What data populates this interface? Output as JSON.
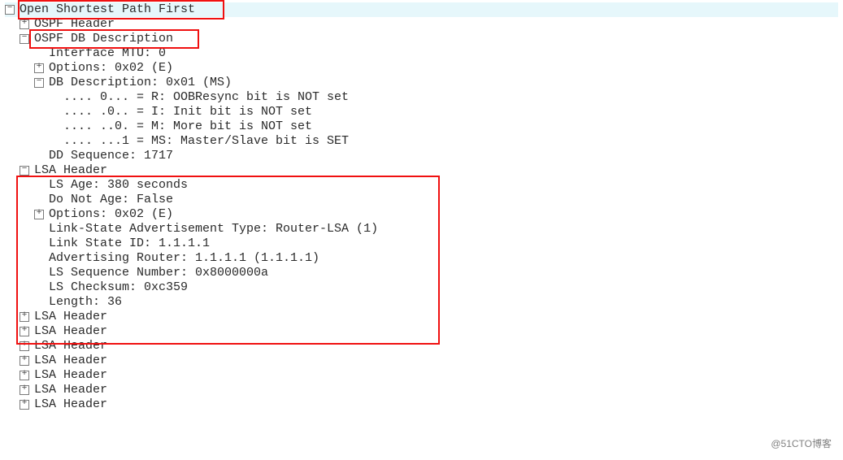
{
  "root": {
    "label": "Open Shortest Path First",
    "children": [
      {
        "label": "OSPF Header",
        "toggle": "plus"
      },
      {
        "label": "OSPF DB Description",
        "toggle": "minus",
        "children": [
          {
            "label": "Interface MTU: 0"
          },
          {
            "label": "Options: 0x02 (E)",
            "toggle": "plus"
          },
          {
            "label": "DB Description: 0x01 (MS)",
            "toggle": "minus",
            "children": [
              {
                "label": ".... 0... = R: OOBResync bit is NOT set"
              },
              {
                "label": ".... .0.. = I: Init bit is NOT set"
              },
              {
                "label": ".... ..0. = M: More bit is NOT set"
              },
              {
                "label": ".... ...1 = MS: Master/Slave bit is SET"
              }
            ]
          },
          {
            "label": "DD Sequence: 1717"
          }
        ]
      },
      {
        "label": "LSA Header",
        "toggle": "minus",
        "children": [
          {
            "label": "LS Age: 380 seconds"
          },
          {
            "label": "Do Not Age: False"
          },
          {
            "label": "Options: 0x02 (E)",
            "toggle": "plus"
          },
          {
            "label": "Link-State Advertisement Type: Router-LSA (1)"
          },
          {
            "label": "Link State ID: 1.1.1.1"
          },
          {
            "label": "Advertising Router: 1.1.1.1 (1.1.1.1)"
          },
          {
            "label": "LS Sequence Number: 0x8000000a"
          },
          {
            "label": "LS Checksum: 0xc359"
          },
          {
            "label": "Length: 36"
          }
        ]
      },
      {
        "label": "LSA Header",
        "toggle": "plus"
      },
      {
        "label": "LSA Header",
        "toggle": "plus"
      },
      {
        "label": "LSA Header",
        "toggle": "plus"
      },
      {
        "label": "LSA Header",
        "toggle": "plus"
      },
      {
        "label": "LSA Header",
        "toggle": "plus"
      },
      {
        "label": "LSA Header",
        "toggle": "plus"
      },
      {
        "label": "LSA Header",
        "toggle": "plus"
      }
    ]
  },
  "watermark": "@51CTO博客"
}
